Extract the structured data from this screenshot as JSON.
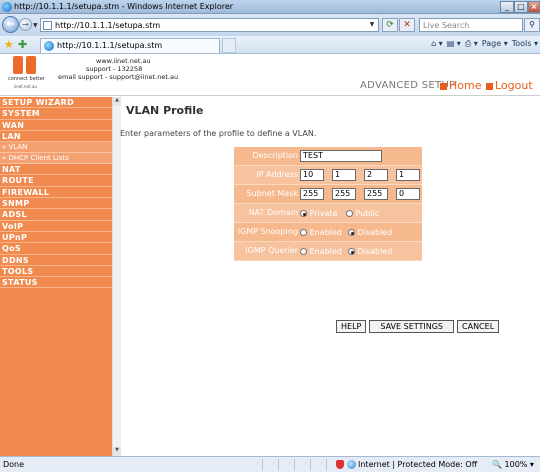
{
  "browser": {
    "window_title": "http://10.1.1.1/setupa.stm - Windows Internet Explorer",
    "url": "http://10.1.1.1/setupa.stm",
    "search_placeholder": "Live Search",
    "tab_title": "http://10.1.1.1/setupa.stm",
    "cmd": {
      "home": "⌂ ▾",
      "feeds": "▤ ▾",
      "print": "⎙ ▾",
      "page": "Page ▾",
      "tools": "Tools ▾"
    },
    "status_text": "Done",
    "zone_text": "Internet | Protected Mode: Off",
    "zoom_text": "100%"
  },
  "header": {
    "logo_tag": "connect better",
    "logo_sub": "iinet.net.au",
    "contact_line1": "www.iinet.net.au",
    "contact_line2": "support - 132258",
    "contact_line3": "email support - support@iinet.net.au",
    "advanced_setup": "ADVANCED SETUP",
    "home_link": "Home",
    "logout_link": "Logout"
  },
  "sidebar": {
    "items": [
      {
        "label": "SETUP WIZARD",
        "type": "item"
      },
      {
        "label": "SYSTEM",
        "type": "item"
      },
      {
        "label": "WAN",
        "type": "item"
      },
      {
        "label": "LAN",
        "type": "item"
      },
      {
        "label": "» VLAN",
        "type": "sub"
      },
      {
        "label": "» DHCP Client Lists",
        "type": "sub"
      },
      {
        "label": "NAT",
        "type": "item"
      },
      {
        "label": "ROUTE",
        "type": "item"
      },
      {
        "label": "FIREWALL",
        "type": "item"
      },
      {
        "label": "SNMP",
        "type": "item"
      },
      {
        "label": "ADSL",
        "type": "item"
      },
      {
        "label": "VoIP",
        "type": "item"
      },
      {
        "label": "UPnP",
        "type": "item"
      },
      {
        "label": "QoS",
        "type": "item"
      },
      {
        "label": "DDNS",
        "type": "item"
      },
      {
        "label": "TOOLS",
        "type": "item"
      },
      {
        "label": "STATUS",
        "type": "item"
      }
    ]
  },
  "main": {
    "title": "VLAN Profile",
    "description": "Enter parameters of the profile to define a VLAN.",
    "form": {
      "description_label": "Description",
      "description_value": "TEST",
      "ip_label": "IP Address",
      "ip": [
        "10",
        "1",
        "2",
        "1"
      ],
      "mask_label": "Subnet Mask",
      "mask": [
        "255",
        "255",
        "255",
        "0"
      ],
      "nat_label": "NAT Domain",
      "nat_opt1": "Private",
      "nat_opt2": "Public",
      "igmp_snoop_label": "IGMP Snooping",
      "igmp_snoop_opt1": "Enabled",
      "igmp_snoop_opt2": "Disabled",
      "igmp_querier_label": "IGMP Querier",
      "igmp_querier_opt1": "Enabled",
      "igmp_querier_opt2": "Disabled"
    },
    "buttons": {
      "help": "HELP",
      "save": "SAVE SETTINGS",
      "cancel": "CANCEL"
    }
  },
  "colors": {
    "accent": "#f08a4e",
    "form_bg": "#f7c29e",
    "link": "#e85f1b"
  }
}
